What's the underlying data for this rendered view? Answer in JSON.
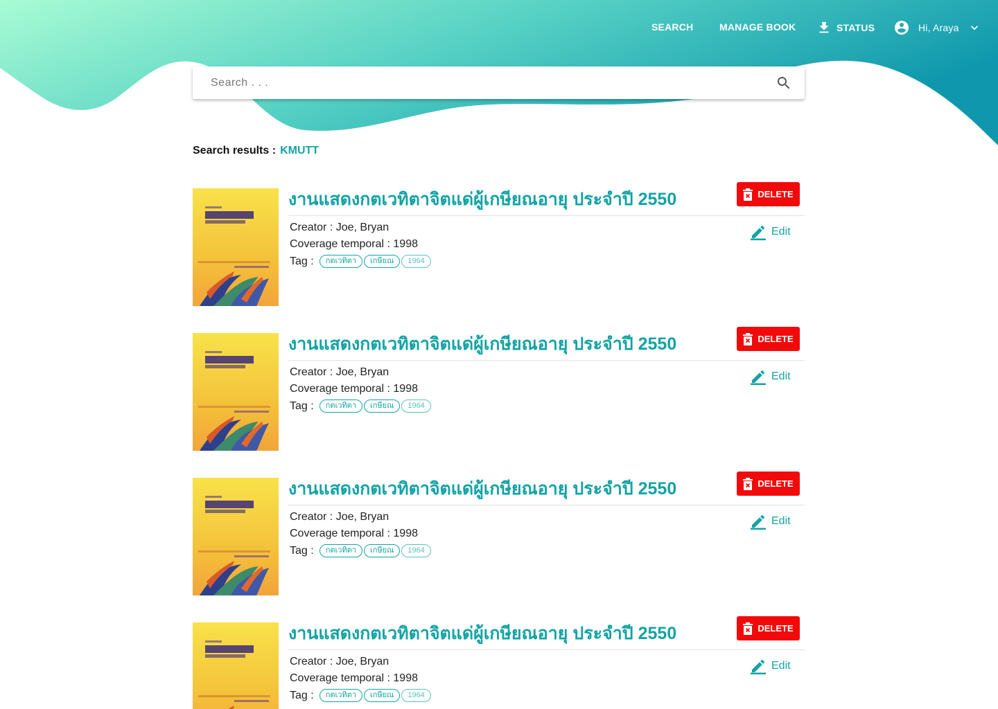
{
  "nav": {
    "search_label": "SEARCH",
    "manage_label": "MANAGE BOOK",
    "status_label": "STATUS",
    "user_label": "Hi, Araya",
    "status_icon": "download-icon",
    "user_icon": "account-circle-icon",
    "user_menu_icon": "chevron-down-icon"
  },
  "search": {
    "placeholder": "Search . . .",
    "value": "",
    "icon": "search-icon"
  },
  "results": {
    "label": "Search results :",
    "query": "KMUTT"
  },
  "books": [
    {
      "title": "งานแสดงกตเวทิตาจิตแด่ผู้เกษียณอายุ ประจำปี 2550",
      "creator": "Creator : Joe, Bryan",
      "coverage": "Coverage temporal : 1998",
      "tags_label": "Tag :",
      "tags": [
        "กตเวทิตา",
        "เกษียณ",
        "1964"
      ],
      "delete_label": "DELETE",
      "edit_label": "Edit"
    },
    {
      "title": "งานแสดงกตเวทิตาจิตแด่ผู้เกษียณอายุ ประจำปี 2550",
      "creator": "Creator : Joe, Bryan",
      "coverage": "Coverage temporal : 1998",
      "tags_label": "Tag :",
      "tags": [
        "กตเวทิตา",
        "เกษียณ",
        "1964"
      ],
      "delete_label": "DELETE",
      "edit_label": "Edit"
    },
    {
      "title": "งานแสดงกตเวทิตาจิตแด่ผู้เกษียณอายุ ประจำปี 2550",
      "creator": "Creator : Joe, Bryan",
      "coverage": "Coverage temporal : 1998",
      "tags_label": "Tag :",
      "tags": [
        "กตเวทิตา",
        "เกษียณ",
        "1964"
      ],
      "delete_label": "DELETE",
      "edit_label": "Edit"
    },
    {
      "title": "งานแสดงกตเวทิตาจิตแด่ผู้เกษียณอายุ ประจำปี 2550",
      "creator": "Creator : Joe, Bryan",
      "coverage": "Coverage temporal : 1998",
      "tags_label": "Tag :",
      "tags": [
        "กตเวทิตา",
        "เกษียณ",
        "1964"
      ],
      "delete_label": "DELETE",
      "edit_label": "Edit"
    }
  ],
  "colors": {
    "accent": "#13a3a5",
    "delete": "#f20a0a",
    "wave_start": "#a8fcd4",
    "wave_end": "#0f9aae"
  }
}
